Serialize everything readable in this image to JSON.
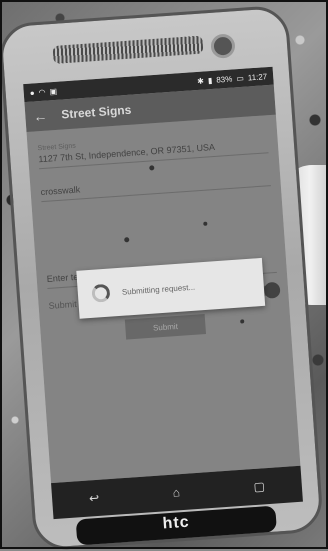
{
  "status_bar": {
    "battery": "83%",
    "time": "11:27"
  },
  "app_bar": {
    "title": "Street Signs"
  },
  "form": {
    "location_label": "Street Signs",
    "address_value": "1127 7th St, Independence, OR 97351, USA",
    "sign_type_value": "crosswalk",
    "notes_placeholder": "Enter text",
    "submit_publicly_label": "Submit publicly?",
    "submit_button": "Submit"
  },
  "dialog": {
    "message": "Submitting request..."
  },
  "device": {
    "brand": "htc"
  }
}
